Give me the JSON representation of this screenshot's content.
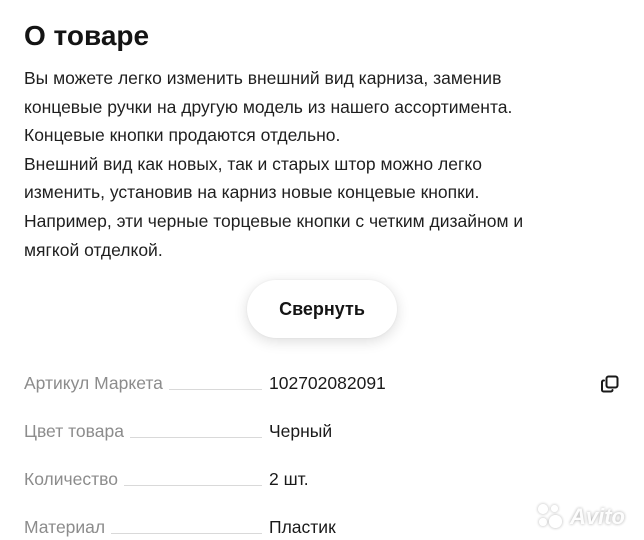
{
  "section": {
    "title": "О товаре"
  },
  "description": {
    "lines": [
      "Вы можете легко изменить внешний вид карниза, заменив",
      "концевые ручки на другую модель из нашего ассортимента.",
      "Концевые кнопки продаются отдельно.",
      "Внешний вид как новых, так и старых штор можно легко",
      "изменить, установив на карниз новые концевые кнопки.",
      "Например, эти черные торцевые кнопки с четким дизайном и",
      "мягкой отделкой."
    ]
  },
  "collapse_button": {
    "label": "Свернуть"
  },
  "specs": [
    {
      "label": "Артикул Маркета",
      "value": "102702082091"
    },
    {
      "label": "Цвет товара",
      "value": "Черный"
    },
    {
      "label": "Количество",
      "value": "2 шт."
    },
    {
      "label": "Материал",
      "value": "Пластик"
    }
  ],
  "icons": {
    "copy": "copy-icon"
  },
  "watermark": {
    "text": "Avito"
  }
}
